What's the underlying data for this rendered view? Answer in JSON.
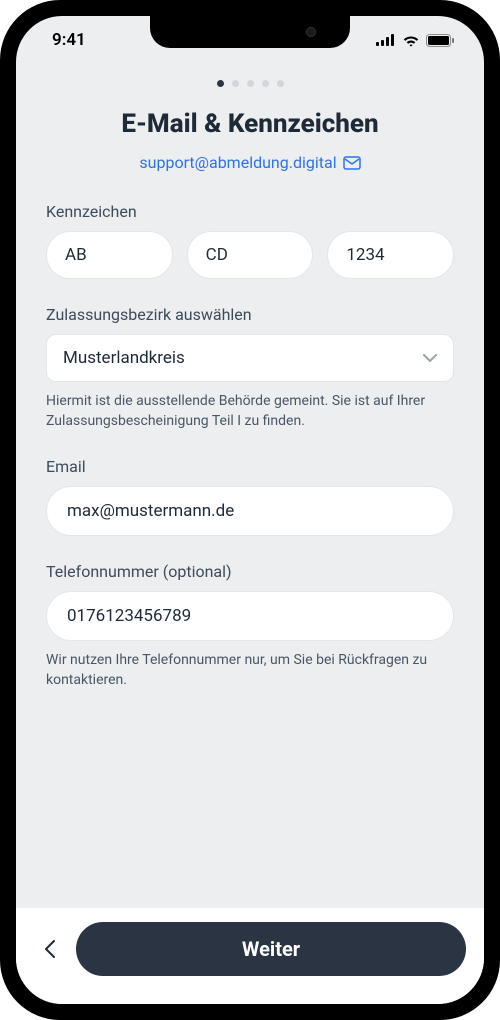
{
  "status": {
    "time": "9:41"
  },
  "page": {
    "title": "E-Mail & Kennzeichen",
    "support_email": "support@abmeldung.digital"
  },
  "plate": {
    "label": "Kennzeichen",
    "part1": "AB",
    "part2": "CD",
    "part3": "1234"
  },
  "district": {
    "label": "Zulassungsbezirk auswählen",
    "value": "Musterlandkreis",
    "helper": "Hiermit ist die ausstellende Behörde gemeint. Sie ist auf Ihrer Zulassungsbescheinigung Teil I zu finden."
  },
  "email": {
    "label": "Email",
    "value": "max@mustermann.de"
  },
  "phone": {
    "label": "Telefonnummer (optional)",
    "value": "0176123456789",
    "helper": "Wir nutzen Ihre Telefonnummer nur, um Sie bei Rückfragen zu kontaktieren."
  },
  "buttons": {
    "continue": "Weiter"
  }
}
